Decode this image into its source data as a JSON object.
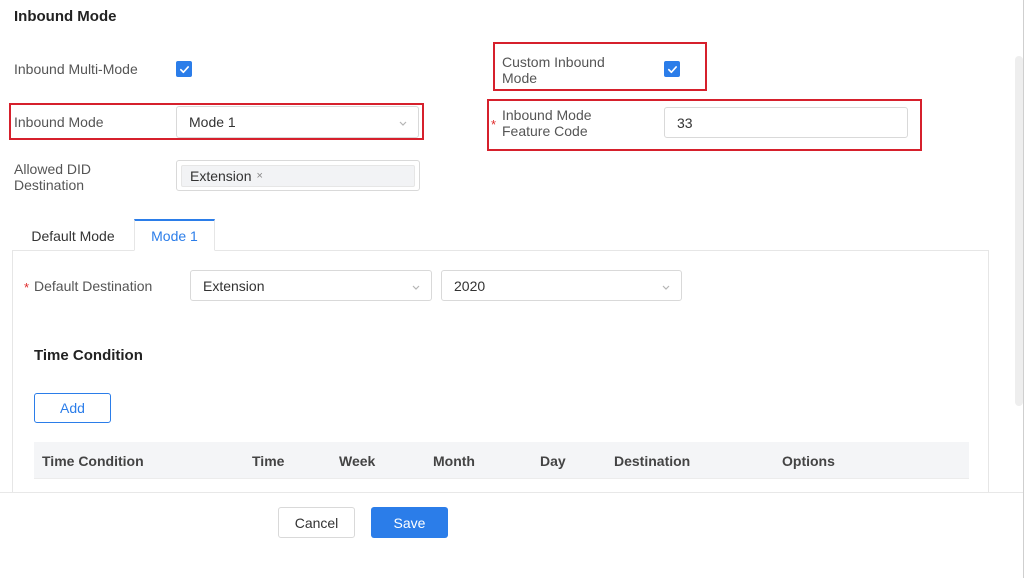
{
  "section": {
    "title": "Inbound Mode"
  },
  "form": {
    "multi_mode": {
      "label": "Inbound Multi-Mode",
      "checked": true
    },
    "custom_mode": {
      "label_line1": "Custom Inbound",
      "label_line2": "Mode",
      "checked": true
    },
    "inbound_mode": {
      "label": "Inbound Mode",
      "value": "Mode 1"
    },
    "feature_code": {
      "required_mark": "*",
      "label_line1": "Inbound Mode",
      "label_line2": "Feature Code",
      "value": "33"
    },
    "allowed_did": {
      "label_line1": "Allowed DID",
      "label_line2": "Destination",
      "tag": "Extension",
      "tag_remove": "×"
    }
  },
  "tabs": [
    {
      "label": "Default Mode",
      "active": false
    },
    {
      "label": "Mode 1",
      "active": true
    }
  ],
  "mode_panel": {
    "default_destination": {
      "required_mark": "*",
      "label": "Default Destination",
      "type_value": "Extension",
      "target_value": "2020"
    },
    "time_condition": {
      "title": "Time Condition",
      "add_label": "Add",
      "columns": [
        "Time Condition",
        "Time",
        "Week",
        "Month",
        "Day",
        "Destination",
        "Options"
      ]
    }
  },
  "footer": {
    "cancel_label": "Cancel",
    "save_label": "Save"
  },
  "colors": {
    "accent": "#2b7de9",
    "highlight_border": "#d6202c",
    "required": "#e02a2a"
  },
  "icons": [
    "checkbox-check-icon",
    "chevron-down-icon",
    "close-icon"
  ]
}
